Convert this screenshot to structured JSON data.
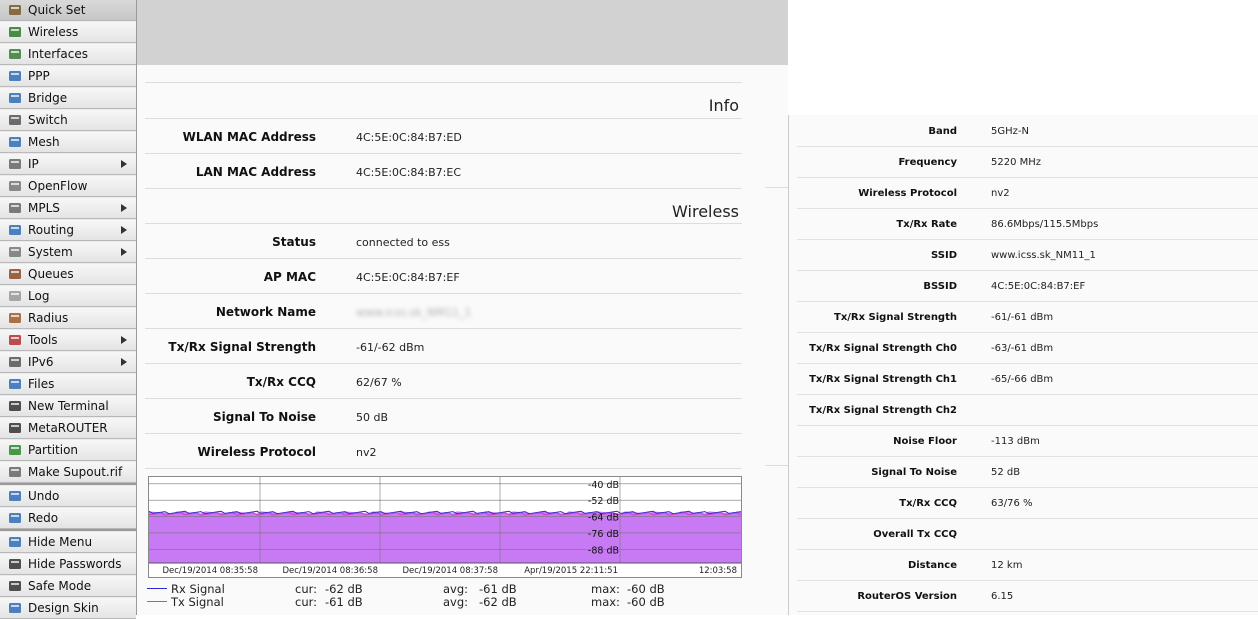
{
  "sidebar": {
    "items": [
      {
        "label": "Quick Set",
        "icon": "quickset-icon",
        "submenu": false,
        "active": true
      },
      {
        "label": "Wireless",
        "icon": "wireless-icon",
        "submenu": false
      },
      {
        "label": "Interfaces",
        "icon": "interfaces-icon",
        "submenu": false
      },
      {
        "label": "PPP",
        "icon": "ppp-icon",
        "submenu": false
      },
      {
        "label": "Bridge",
        "icon": "bridge-icon",
        "submenu": false
      },
      {
        "label": "Switch",
        "icon": "switch-icon",
        "submenu": false
      },
      {
        "label": "Mesh",
        "icon": "mesh-icon",
        "submenu": false
      },
      {
        "label": "IP",
        "icon": "ip-icon",
        "submenu": true
      },
      {
        "label": "OpenFlow",
        "icon": "openflow-icon",
        "submenu": false
      },
      {
        "label": "MPLS",
        "icon": "mpls-icon",
        "submenu": true
      },
      {
        "label": "Routing",
        "icon": "routing-icon",
        "submenu": true
      },
      {
        "label": "System",
        "icon": "system-icon",
        "submenu": true
      },
      {
        "label": "Queues",
        "icon": "queues-icon",
        "submenu": false
      },
      {
        "label": "Log",
        "icon": "log-icon",
        "submenu": false
      },
      {
        "label": "Radius",
        "icon": "radius-icon",
        "submenu": false
      },
      {
        "label": "Tools",
        "icon": "tools-icon",
        "submenu": true
      },
      {
        "label": "IPv6",
        "icon": "ipv6-icon",
        "submenu": true
      },
      {
        "label": "Files",
        "icon": "files-icon",
        "submenu": false
      },
      {
        "label": "New Terminal",
        "icon": "terminal-icon",
        "submenu": false
      },
      {
        "label": "MetaROUTER",
        "icon": "metarouter-icon",
        "submenu": false
      },
      {
        "label": "Partition",
        "icon": "partition-icon",
        "submenu": false
      },
      {
        "label": "Make Supout.rif",
        "icon": "supout-icon",
        "submenu": false
      }
    ],
    "items2": [
      {
        "label": "Undo",
        "icon": "undo-icon"
      },
      {
        "label": "Redo",
        "icon": "redo-icon"
      }
    ],
    "items3": [
      {
        "label": "Hide Menu",
        "icon": "hide-menu-icon"
      },
      {
        "label": "Hide Passwords",
        "icon": "hide-passwords-icon"
      },
      {
        "label": "Safe Mode",
        "icon": "safe-mode-icon"
      },
      {
        "label": "Design Skin",
        "icon": "design-skin-icon"
      }
    ]
  },
  "info": {
    "title": "Info",
    "rows": [
      {
        "label": "WLAN MAC Address",
        "value": "4C:5E:0C:84:B7:ED"
      },
      {
        "label": "LAN MAC Address",
        "value": "4C:5E:0C:84:B7:EC"
      }
    ]
  },
  "wireless": {
    "title": "Wireless",
    "rows": [
      {
        "label": "Status",
        "value": "connected to ess"
      },
      {
        "label": "AP MAC",
        "value": "4C:5E:0C:84:B7:EF"
      },
      {
        "label": "Network Name",
        "value": "www.icss.sk_NM11_1",
        "blurred": true
      },
      {
        "label": "Tx/Rx Signal Strength",
        "value": "-61/-62 dBm"
      },
      {
        "label": "Tx/Rx CCQ",
        "value": "62/67 %"
      },
      {
        "label": "Signal To Noise",
        "value": "50 dB"
      },
      {
        "label": "Wireless Protocol",
        "value": "nv2"
      }
    ]
  },
  "chart_data": {
    "type": "area",
    "y_tick_labels": [
      "-40 dB",
      "-52 dB",
      "-64 dB",
      "-76 dB",
      "-88 dB"
    ],
    "y_ticks": [
      -40,
      -52,
      -64,
      -76,
      -88
    ],
    "ylim": [
      -35,
      -98
    ],
    "x_tick_labels": [
      "Dec/19/2014 08:35:58",
      "Dec/19/2014 08:36:58",
      "Dec/19/2014 08:37:58",
      "Apr/19/2015 22:11:51",
      "12:03:58"
    ],
    "series": [
      {
        "name": "Rx Signal",
        "color": "#2a2ad0",
        "cur": "-62 dB",
        "avg": "-61 dB",
        "max": "-60 dB",
        "level": -61
      },
      {
        "name": "Tx Signal",
        "color": "#d13ed1",
        "cur": "-61 dB",
        "avg": "-62 dB",
        "max": "-60 dB",
        "level": -62
      }
    ],
    "fill_color": "#c77af3",
    "legend": {
      "cur_prefix": "cur:",
      "avg_prefix": "avg:",
      "max_prefix": "max:"
    }
  },
  "right_panel": {
    "rows": [
      {
        "label": "Band",
        "value": "5GHz-N"
      },
      {
        "label": "Frequency",
        "value": "5220 MHz"
      },
      {
        "label": "Wireless Protocol",
        "value": "nv2"
      },
      {
        "label": "Tx/Rx Rate",
        "value": "86.6Mbps/115.5Mbps"
      },
      {
        "label": "SSID",
        "value": "www.icss.sk_NM11_1"
      },
      {
        "label": "BSSID",
        "value": "4C:5E:0C:84:B7:EF"
      },
      {
        "label": "Tx/Rx Signal Strength",
        "value": "-61/-61 dBm"
      },
      {
        "label": "Tx/Rx Signal Strength Ch0",
        "value": "-63/-61 dBm"
      },
      {
        "label": "Tx/Rx Signal Strength Ch1",
        "value": "-65/-66 dBm"
      },
      {
        "label": "Tx/Rx Signal Strength Ch2",
        "value": ""
      },
      {
        "label": "Noise Floor",
        "value": "-113 dBm"
      },
      {
        "label": "Signal To Noise",
        "value": "52 dB"
      },
      {
        "label": "Tx/Rx CCQ",
        "value": "63/76 %"
      },
      {
        "label": "Overall Tx CCQ",
        "value": ""
      },
      {
        "label": "Distance",
        "value": "12 km"
      },
      {
        "label": "RouterOS Version",
        "value": "6.15"
      }
    ]
  }
}
